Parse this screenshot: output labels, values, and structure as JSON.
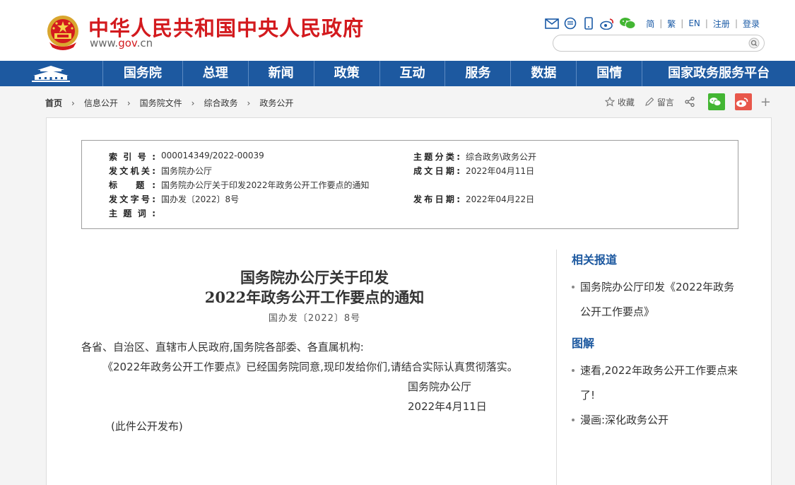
{
  "header": {
    "site_title": "中华人民共和国中央人民政府",
    "site_url_prefix": "www.",
    "site_url_brand": "gov",
    "site_url_suffix": ".cn",
    "top_links": [
      "简",
      "繁",
      "EN",
      "注册",
      "登录"
    ],
    "search_placeholder": ""
  },
  "nav": {
    "items": [
      "国务院",
      "总理",
      "新闻",
      "政策",
      "互动",
      "服务",
      "数据",
      "国情",
      "国家政务服务平台"
    ]
  },
  "breadcrumb": [
    "首页",
    "信息公开",
    "国务院文件",
    "综合政务",
    "政务公开"
  ],
  "share": {
    "favorite": "收藏",
    "comment": "留言"
  },
  "meta": {
    "index_label": "索引号:",
    "index_value": "000014349/2022-00039",
    "category_label": "主题分类:",
    "category_value": "综合政务\\政务公开",
    "issuer_label": "发文机关:",
    "issuer_value": "国务院办公厅",
    "written_label": "成文日期:",
    "written_value": "2022年04月11日",
    "title_label": "标 题:",
    "title_value": "国务院办公厅关于印发2022年政务公开工作要点的通知",
    "doc_no_label": "发文字号:",
    "doc_no_value": "国办发〔2022〕8号",
    "publish_label": "发布日期:",
    "publish_value": "2022年04月22日",
    "keywords_label": "主题词:",
    "keywords_value": ""
  },
  "article": {
    "title_line1": "国务院办公厅关于印发",
    "title_line2": "2022年政务公开工作要点的通知",
    "doc_number": "国办发〔2022〕8号",
    "salutation": "各省、自治区、直辖市人民政府,国务院各部委、各直属机构:",
    "body": "《2022年政务公开工作要点》已经国务院同意,现印发给你们,请结合实际认真贯彻落实。",
    "signer": "国务院办公厅",
    "sign_date": "2022年4月11日",
    "note": "(此件公开发布)"
  },
  "sidebar": {
    "related_title": "相关报道",
    "related_items": [
      "国务院办公厅印发《2022年政务公开工作要点》"
    ],
    "graphic_title": "图解",
    "graphic_items": [
      "速看,2022年政务公开工作要点来了!",
      "漫画:深化政务公开"
    ]
  },
  "colors": {
    "brand_red": "#d31a1e",
    "nav_blue": "#1d59a0",
    "link_blue": "#1a5aa6"
  }
}
